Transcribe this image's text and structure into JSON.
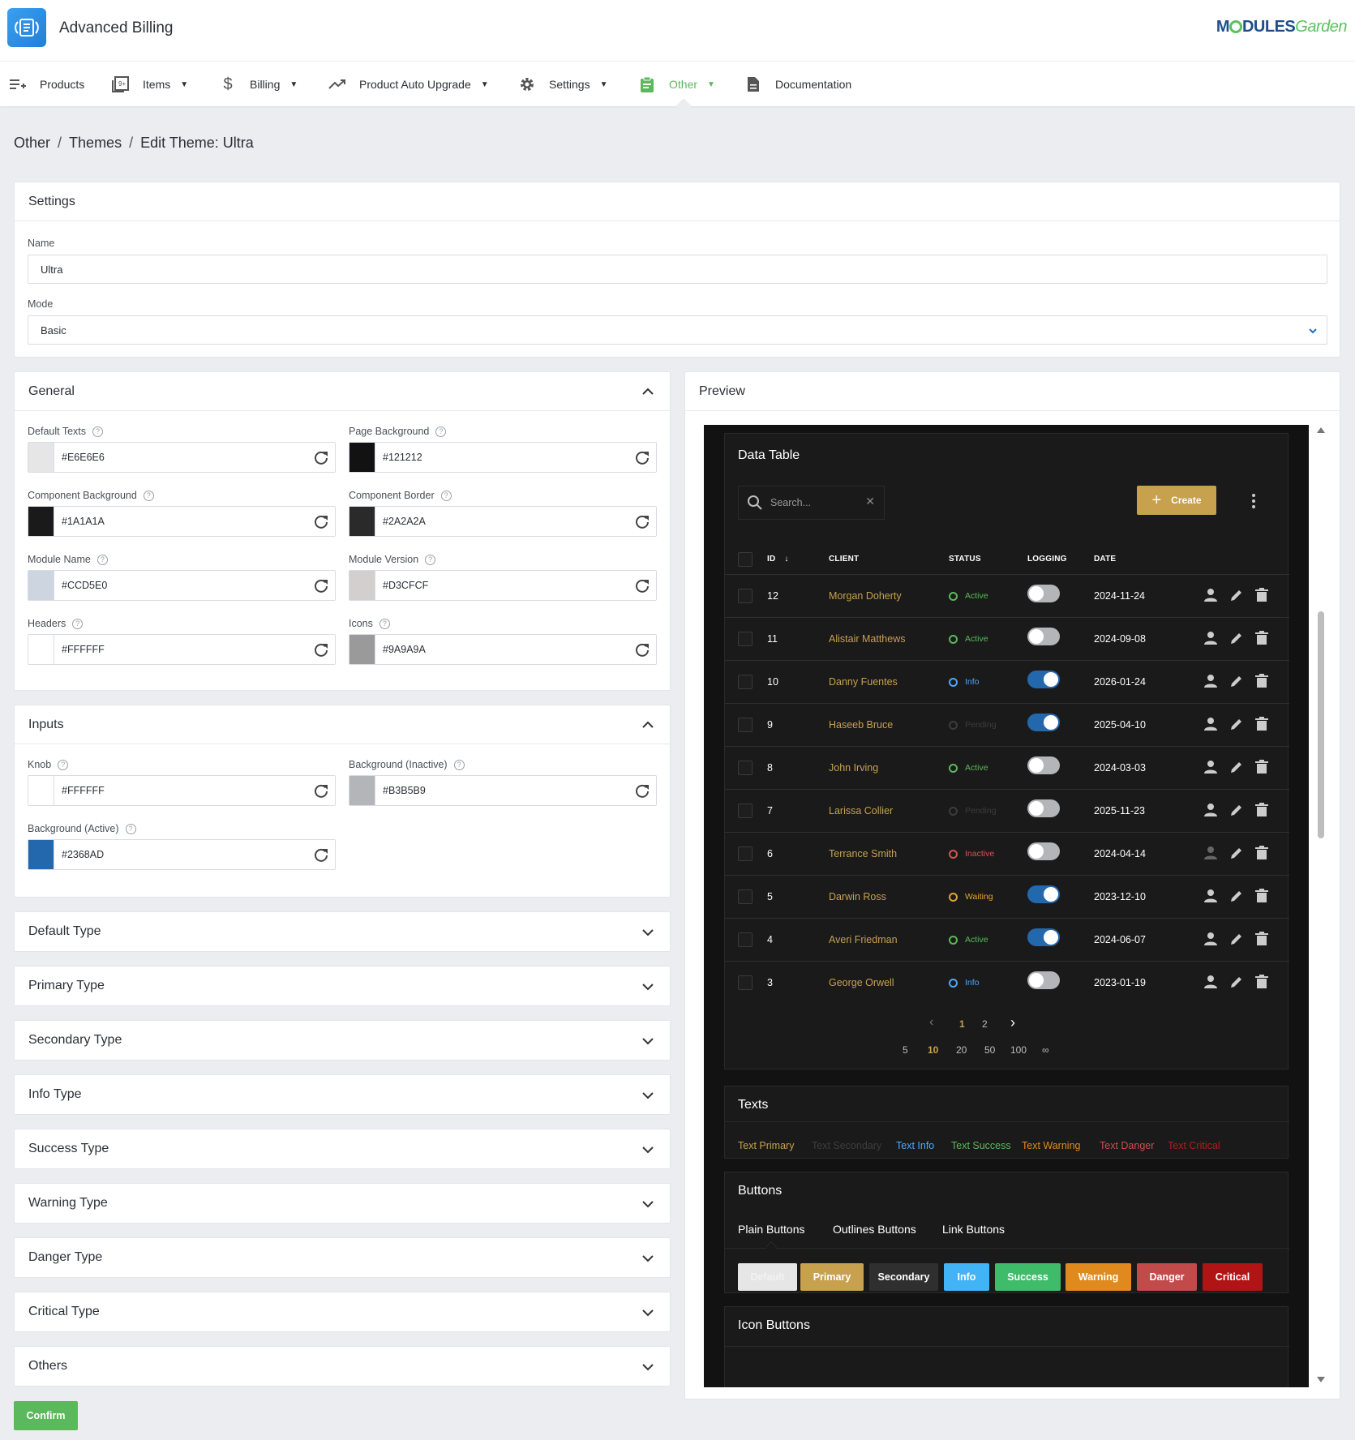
{
  "header": {
    "app_title": "Advanced Billing",
    "brand_part1": "M",
    "brand_part2": "DULES",
    "brand_part3": "Garden"
  },
  "nav": [
    {
      "label": "Products",
      "icon": "playlist-add-icon",
      "caret": false,
      "active": false
    },
    {
      "label": "Items",
      "icon": "items-icon",
      "caret": true,
      "active": false
    },
    {
      "label": "Billing",
      "icon": "dollar-icon",
      "caret": true,
      "active": false
    },
    {
      "label": "Product Auto Upgrade",
      "icon": "trending-up-icon",
      "caret": true,
      "active": false
    },
    {
      "label": "Settings",
      "icon": "gear-icon",
      "caret": true,
      "active": false
    },
    {
      "label": "Other",
      "icon": "clipboard-icon",
      "caret": true,
      "active": true
    },
    {
      "label": "Documentation",
      "icon": "document-icon",
      "caret": false,
      "active": false
    }
  ],
  "breadcrumb": [
    "Other",
    "Themes",
    "Edit Theme: Ultra"
  ],
  "settings": {
    "title": "Settings",
    "name_label": "Name",
    "name_value": "Ultra",
    "mode_label": "Mode",
    "mode_value": "Basic"
  },
  "general": {
    "title": "General",
    "fields": [
      {
        "label": "Default Texts",
        "value": "#E6E6E6",
        "color": "#E6E6E6"
      },
      {
        "label": "Page Background",
        "value": "#121212",
        "color": "#121212"
      },
      {
        "label": "Component Background",
        "value": "#1A1A1A",
        "color": "#1A1A1A"
      },
      {
        "label": "Component Border",
        "value": "#2A2A2A",
        "color": "#2A2A2A"
      },
      {
        "label": "Module Name",
        "value": "#CCD5E0",
        "color": "#CCD5E0"
      },
      {
        "label": "Module Version",
        "value": "#D3CFCF",
        "color": "#D3CFCF"
      },
      {
        "label": "Headers",
        "value": "#FFFFFF",
        "color": "#FFFFFF"
      },
      {
        "label": "Icons",
        "value": "#9A9A9A",
        "color": "#9A9A9A"
      }
    ]
  },
  "inputs": {
    "title": "Inputs",
    "fields": [
      {
        "label": "Knob",
        "value": "#FFFFFF",
        "color": "#FFFFFF"
      },
      {
        "label": "Background (Inactive)",
        "value": "#B3B5B9",
        "color": "#B3B5B9"
      },
      {
        "label": "Background (Active)",
        "value": "#2368AD",
        "color": "#2368AD"
      }
    ]
  },
  "sections": [
    "Default Type",
    "Primary Type",
    "Secondary Type",
    "Info Type",
    "Success Type",
    "Warning Type",
    "Danger Type",
    "Critical Type",
    "Others"
  ],
  "confirm_label": "Confirm",
  "preview": {
    "title": "Preview",
    "data_table": {
      "title": "Data Table",
      "search_placeholder": "Search...",
      "create_label": "Create",
      "columns": [
        "ID",
        "CLIENT",
        "STATUS",
        "LOGGING",
        "DATE"
      ],
      "rows": [
        {
          "id": "12",
          "client": "Morgan Doherty",
          "status": "Active",
          "status_color": "#5cb85c",
          "logging": false,
          "date": "2024-11-24"
        },
        {
          "id": "11",
          "client": "Alistair Matthews",
          "status": "Active",
          "status_color": "#5cb85c",
          "logging": false,
          "date": "2024-09-08"
        },
        {
          "id": "10",
          "client": "Danny Fuentes",
          "status": "Info",
          "status_color": "#4aa8ff",
          "logging": true,
          "date": "2026-01-24"
        },
        {
          "id": "9",
          "client": "Haseeb Bruce",
          "status": "Pending",
          "status_color": "#3c3c3c",
          "logging": true,
          "date": "2025-04-10"
        },
        {
          "id": "8",
          "client": "John Irving",
          "status": "Active",
          "status_color": "#5cb85c",
          "logging": false,
          "date": "2024-03-03"
        },
        {
          "id": "7",
          "client": "Larissa Collier",
          "status": "Pending",
          "status_color": "#3c3c3c",
          "logging": false,
          "date": "2025-11-23"
        },
        {
          "id": "6",
          "client": "Terrance Smith",
          "status": "Inactive",
          "status_color": "#d9534f",
          "logging": false,
          "date": "2024-04-14"
        },
        {
          "id": "5",
          "client": "Darwin Ross",
          "status": "Waiting",
          "status_color": "#e0a82e",
          "logging": true,
          "date": "2023-12-10"
        },
        {
          "id": "4",
          "client": "Averi Friedman",
          "status": "Active",
          "status_color": "#5cb85c",
          "logging": true,
          "date": "2024-06-07"
        },
        {
          "id": "3",
          "client": "George Orwell",
          "status": "Info",
          "status_color": "#4aa8ff",
          "logging": false,
          "date": "2023-01-19"
        }
      ],
      "pages": [
        "1",
        "2"
      ],
      "current_page": "1",
      "page_sizes": [
        "5",
        "10",
        "20",
        "50",
        "100",
        "∞"
      ],
      "current_page_size": "10"
    },
    "texts": {
      "title": "Texts",
      "items": [
        {
          "label": "Text Primary",
          "color": "#c7a14e"
        },
        {
          "label": "Text Secondary",
          "color": "#3d3d3d"
        },
        {
          "label": "Text Info",
          "color": "#4aa8ff"
        },
        {
          "label": "Text Success",
          "color": "#5cb85c"
        },
        {
          "label": "Text Warning",
          "color": "#e08a1e"
        },
        {
          "label": "Text Danger",
          "color": "#c9504c"
        },
        {
          "label": "Text Critical",
          "color": "#b01e1e"
        }
      ]
    },
    "buttons": {
      "title": "Buttons",
      "tabs": [
        "Plain Buttons",
        "Outlines Buttons",
        "Link Buttons"
      ],
      "items": [
        {
          "label": "Default",
          "bg": "#e6e6e6",
          "fg": "#f2f2f2"
        },
        {
          "label": "Primary",
          "bg": "#c7a14e",
          "fg": "#ffffff"
        },
        {
          "label": "Secondary",
          "bg": "#2f2f2f",
          "fg": "#ffffff"
        },
        {
          "label": "Info",
          "bg": "#42b3f5",
          "fg": "#ffffff"
        },
        {
          "label": "Success",
          "bg": "#3fbc6a",
          "fg": "#ffffff"
        },
        {
          "label": "Warning",
          "bg": "#e08a1e",
          "fg": "#ffffff"
        },
        {
          "label": "Danger",
          "bg": "#c24a4a",
          "fg": "#ffffff"
        },
        {
          "label": "Critical",
          "bg": "#b01414",
          "fg": "#ffffff"
        }
      ]
    },
    "icon_buttons": {
      "title": "Icon Buttons"
    }
  }
}
